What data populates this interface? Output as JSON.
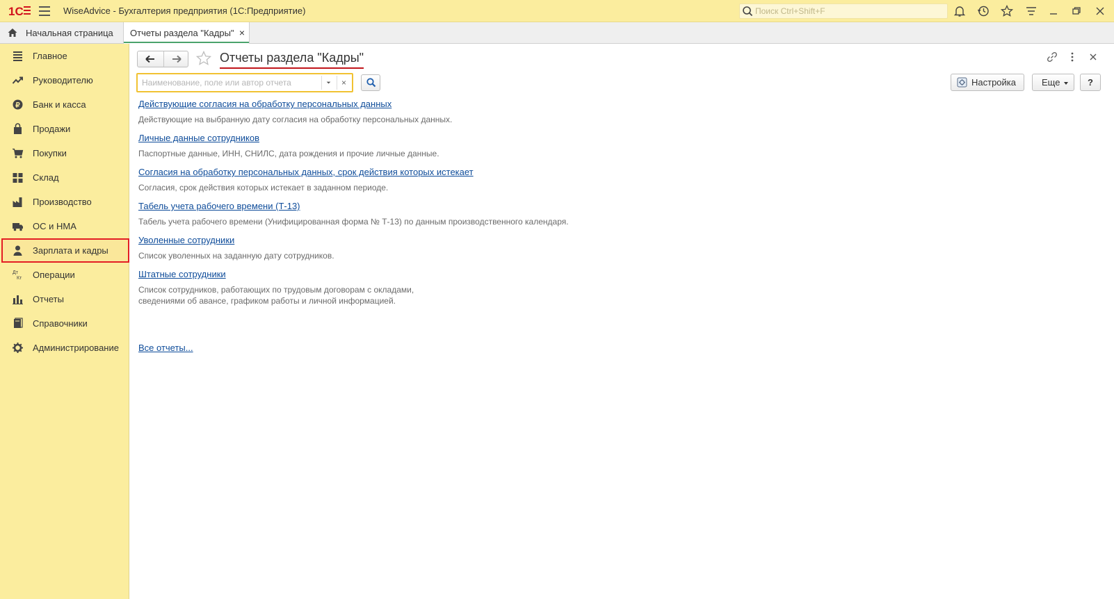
{
  "titlebar": {
    "app_title": "WiseAdvice - Бухгалтерия предприятия  (1С:Предприятие)",
    "search_placeholder": "Поиск Ctrl+Shift+F",
    "logo": "1С",
    "icons": [
      "bell-icon",
      "history-icon",
      "star-icon",
      "menu-lines-icon",
      "minimize-icon",
      "restore-icon",
      "close-icon"
    ]
  },
  "tabs": {
    "home_label": "Начальная страница",
    "active_label": "Отчеты раздела \"Кадры\"",
    "close_glyph": "×"
  },
  "sidebar": {
    "items": [
      {
        "label": "Главное",
        "icon": "list-icon"
      },
      {
        "label": "Руководителю",
        "icon": "trend-icon"
      },
      {
        "label": "Банк и касса",
        "icon": "coin-icon"
      },
      {
        "label": "Продажи",
        "icon": "bag-icon"
      },
      {
        "label": "Покупки",
        "icon": "cart-icon"
      },
      {
        "label": "Склад",
        "icon": "warehouse-icon"
      },
      {
        "label": "Производство",
        "icon": "factory-icon"
      },
      {
        "label": "ОС и НМА",
        "icon": "truck-icon"
      },
      {
        "label": "Зарплата и кадры",
        "icon": "person-icon",
        "active": true
      },
      {
        "label": "Операции",
        "icon": "dt-kt-icon"
      },
      {
        "label": "Отчеты",
        "icon": "bar-chart-icon"
      },
      {
        "label": "Справочники",
        "icon": "books-icon"
      },
      {
        "label": "Администрирование",
        "icon": "gear-icon"
      }
    ]
  },
  "main": {
    "title": "Отчеты раздела \"Кадры\"",
    "search_placeholder": "Наименование, поле или автор отчета",
    "settings_label": "Настройка",
    "more_label": "Еще",
    "help_label": "?",
    "clear_glyph": "×",
    "reports": [
      {
        "title": "Действующие согласия на обработку персональных данных",
        "desc": [
          "Действующие на выбранную дату согласия на обработку персональных данных."
        ]
      },
      {
        "title": "Личные данные сотрудников",
        "desc": [
          "Паспортные данные, ИНН, СНИЛС, дата рождения и прочие личные данные."
        ]
      },
      {
        "title": "Согласия на обработку персональных данных, срок действия которых истекает",
        "desc": [
          "Согласия, срок действия которых истекает в заданном периоде."
        ]
      },
      {
        "title": "Табель учета рабочего времени (Т-13)",
        "desc": [
          "Табель учета рабочего времени (Унифицированная форма № Т-13) по данным производственного календаря."
        ]
      },
      {
        "title": "Уволенные сотрудники",
        "desc": [
          "Список уволенных на заданную дату сотрудников."
        ]
      },
      {
        "title": "Штатные сотрудники",
        "desc": [
          "Список сотрудников, работающих по трудовым договорам с окладами,",
          "сведениями об авансе, графиком работы и личной информацией."
        ]
      }
    ],
    "all_reports_label": "Все отчеты..."
  },
  "colors": {
    "panel_yellow": "#fbed9e",
    "link_blue": "#0e4c9a",
    "highlight_red": "#e31e24",
    "search_border": "#f1c232"
  }
}
